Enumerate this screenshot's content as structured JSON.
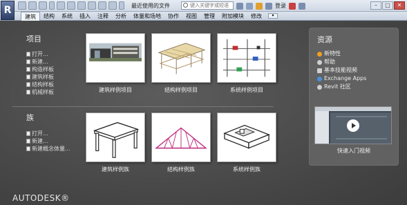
{
  "app": {
    "logo_letter": "R"
  },
  "titlebar": {
    "title": "最近使用的文件",
    "search_placeholder": "键入关键字或短语",
    "login_label": "登录",
    "window_buttons": [
      "–",
      "□",
      "✕"
    ]
  },
  "ribbon": {
    "tabs": [
      "建筑",
      "结构",
      "系统",
      "插入",
      "注释",
      "分析",
      "体量和场地",
      "协作",
      "视图",
      "管理",
      "附加模块",
      "修改"
    ],
    "active_tab": "建筑",
    "dropdown_label": "▾"
  },
  "projects": {
    "title": "项目",
    "items": [
      "打开...",
      "新建...",
      "构造样板",
      "建筑样板",
      "结构样板",
      "机械样板"
    ],
    "samples": [
      {
        "label": "建筑样例项目",
        "icon": "building-render-icon"
      },
      {
        "label": "结构样例项目",
        "icon": "structure-model-icon"
      },
      {
        "label": "系统样例项目",
        "icon": "mep-systems-icon"
      }
    ]
  },
  "families": {
    "title": "族",
    "items": [
      "打开...",
      "新建...",
      "新建概念体量..."
    ],
    "samples": [
      {
        "label": "建筑样例族",
        "icon": "table-family-icon"
      },
      {
        "label": "结构样例族",
        "icon": "truss-family-icon"
      },
      {
        "label": "系统样例族",
        "icon": "duct-family-icon"
      }
    ]
  },
  "resources": {
    "title": "资源",
    "items": [
      {
        "label": "新特性",
        "icon": "bulb-icon",
        "color": "#f0a020"
      },
      {
        "label": "帮助",
        "icon": "help-icon",
        "color": "#d0d0d0"
      },
      {
        "label": "基本技能视频",
        "icon": "video-icon",
        "color": "#d0d0d0"
      },
      {
        "label": "Exchange Apps",
        "icon": "exchange-icon",
        "color": "#4a90d9"
      },
      {
        "label": "Revit 社区",
        "icon": "community-icon",
        "color": "#d0d0d0"
      }
    ],
    "video_label": "快速入门视频"
  },
  "footer": {
    "brand": "AUTODESK®"
  },
  "colors": {
    "background": "#4a4a4a",
    "panel": "#616161",
    "text": "#eeeeee"
  }
}
